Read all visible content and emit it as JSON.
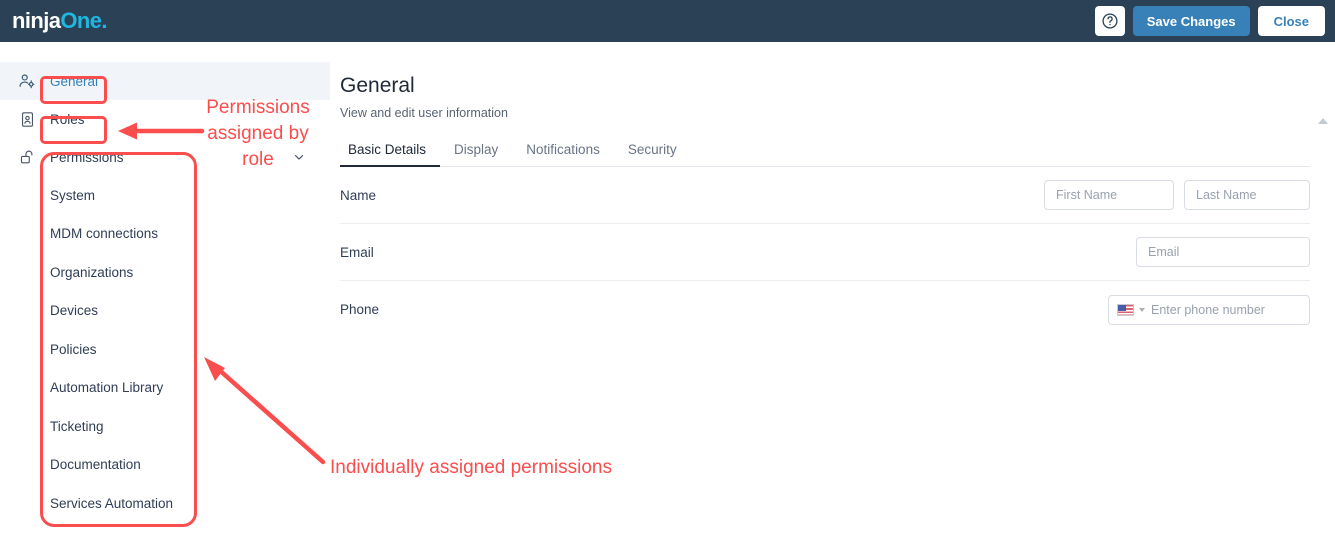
{
  "topbar": {
    "logo_text_1": "ninja",
    "logo_text_2": "One",
    "logo_dot": ".",
    "help_icon": "question-circle-icon",
    "save_label": "Save Changes",
    "close_label": "Close",
    "background_color": "#2b4156",
    "save_button_color": "#3781b8"
  },
  "sidebar": {
    "nav": [
      {
        "label": "General",
        "icon": "user-settings-icon",
        "active": true,
        "highlight": true
      },
      {
        "label": "Roles",
        "icon": "id-badge-icon",
        "active": false,
        "highlight": false
      },
      {
        "label": "Permissions",
        "icon": "open-padlock-icon",
        "active": false,
        "highlight": false,
        "expand_icon": "chevron-down-icon"
      }
    ],
    "permissions_items": [
      {
        "label": "System"
      },
      {
        "label": "MDM connections"
      },
      {
        "label": "Organizations"
      },
      {
        "label": "Devices"
      },
      {
        "label": "Policies"
      },
      {
        "label": "Automation Library"
      },
      {
        "label": "Ticketing"
      },
      {
        "label": "Documentation"
      },
      {
        "label": "Services Automation"
      }
    ]
  },
  "main": {
    "title": "General",
    "subtitle": "View and edit user information",
    "tabs": [
      {
        "label": "Basic Details",
        "active": true
      },
      {
        "label": "Display",
        "active": false
      },
      {
        "label": "Notifications",
        "active": false
      },
      {
        "label": "Security",
        "active": false
      }
    ],
    "form": {
      "name_label": "Name",
      "first_name_placeholder": "First Name",
      "first_name_value": "",
      "last_name_placeholder": "Last Name",
      "last_name_value": "",
      "email_label": "Email",
      "email_placeholder": "Email",
      "email_value": "",
      "phone_label": "Phone",
      "phone_placeholder": "Enter phone number",
      "phone_value": "",
      "phone_country_icon": "us-flag-icon",
      "phone_country_caret": "caret-down-icon"
    },
    "scroll_up_icon": "scroll-up-arrow-icon"
  },
  "annotations": {
    "color": "#fa4d4d",
    "callout_role": "Permissions\nassigned by\nrole",
    "callout_role_line1": "Permissions",
    "callout_role_line2": "assigned by",
    "callout_role_line3": "role",
    "callout_individual": "Individually assigned permissions",
    "arrow_to_roles": "left-arrow-icon",
    "arrow_to_permissions": "diagonal-arrow-icon"
  }
}
